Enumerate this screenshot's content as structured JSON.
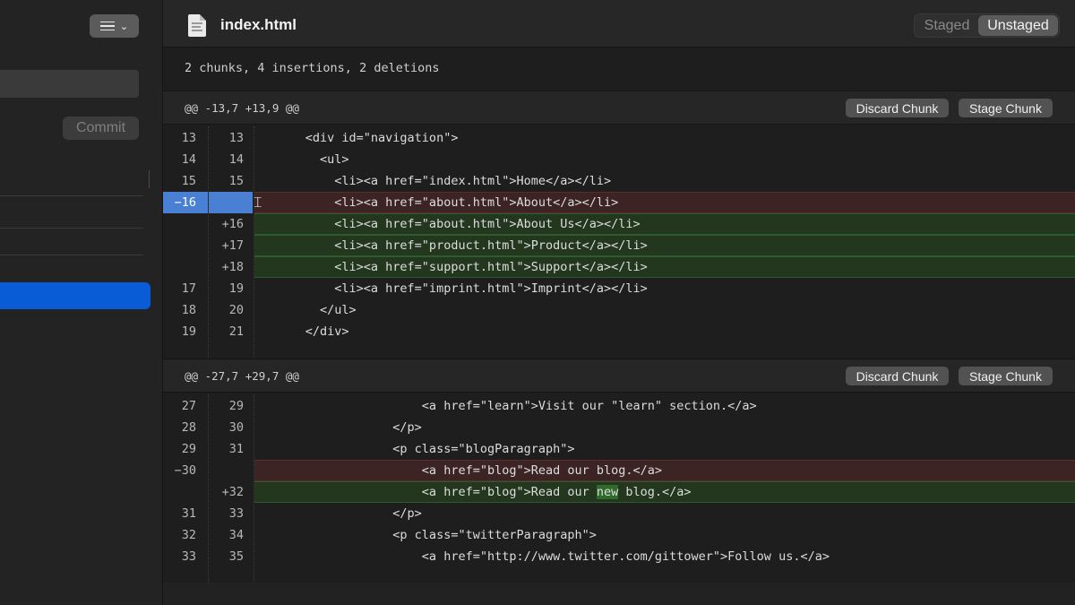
{
  "sidebar": {
    "commit_button": "Commit"
  },
  "header": {
    "filename": "index.html",
    "toggle": {
      "staged": "Staged",
      "unstaged": "Unstaged",
      "active": "Unstaged"
    }
  },
  "summary": "2 chunks, 4 insertions, 2 deletions",
  "hunks": [
    {
      "range": "@@ -13,7 +13,9 @@",
      "discard_label": "Discard Chunk",
      "stage_label": "Stage Chunk",
      "lines": [
        {
          "old": "13",
          "new": "13",
          "type": "ctx",
          "text": "      <div id=\"navigation\">"
        },
        {
          "old": "14",
          "new": "14",
          "type": "ctx",
          "text": "        <ul>"
        },
        {
          "old": "15",
          "new": "15",
          "type": "ctx",
          "text": "          <li><a href=\"index.html\">Home</a></li>"
        },
        {
          "old": "−16",
          "new": "",
          "type": "del",
          "selected": true,
          "text": "          <li><a href=\"about.html\">About</a></li>"
        },
        {
          "old": "",
          "new": "+16",
          "type": "add",
          "text": "          <li><a href=\"about.html\">About Us</a></li>"
        },
        {
          "old": "",
          "new": "+17",
          "type": "add",
          "text": "          <li><a href=\"product.html\">Product</a></li>"
        },
        {
          "old": "",
          "new": "+18",
          "type": "add",
          "text": "          <li><a href=\"support.html\">Support</a></li>"
        },
        {
          "old": "17",
          "new": "19",
          "type": "ctx",
          "text": "          <li><a href=\"imprint.html\">Imprint</a></li>"
        },
        {
          "old": "18",
          "new": "20",
          "type": "ctx",
          "text": "        </ul>"
        },
        {
          "old": "19",
          "new": "21",
          "type": "ctx",
          "text": "      </div>"
        }
      ]
    },
    {
      "range": "@@ -27,7 +29,7 @@",
      "discard_label": "Discard Chunk",
      "stage_label": "Stage Chunk",
      "lines": [
        {
          "old": "27",
          "new": "29",
          "type": "ctx",
          "text": "                      <a href=\"learn\">Visit our \"learn\" section.</a>"
        },
        {
          "old": "28",
          "new": "30",
          "type": "ctx",
          "text": "                  </p>"
        },
        {
          "old": "29",
          "new": "31",
          "type": "ctx",
          "text": "                  <p class=\"blogParagraph\">"
        },
        {
          "old": "−30",
          "new": "",
          "type": "del",
          "text": "                      <a href=\"blog\">Read our blog.</a>"
        },
        {
          "old": "",
          "new": "+32",
          "type": "add",
          "text_pre": "                      <a href=\"blog\">Read our ",
          "text_hl": "new",
          "text_post": " blog.</a>"
        },
        {
          "old": "31",
          "new": "33",
          "type": "ctx",
          "text": "                  </p>"
        },
        {
          "old": "32",
          "new": "34",
          "type": "ctx",
          "text": "                  <p class=\"twitterParagraph\">"
        },
        {
          "old": "33",
          "new": "35",
          "type": "ctx",
          "text": "                      <a href=\"http://www.twitter.com/gittower\">Follow us.</a>"
        }
      ]
    }
  ]
}
